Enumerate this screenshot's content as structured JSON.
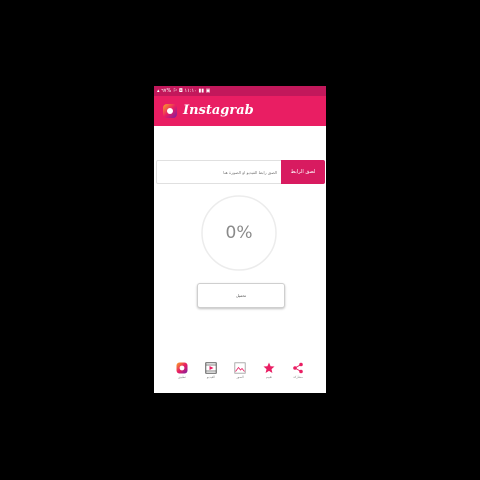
{
  "status_bar": {
    "left_text": "▴ ١١:١٠ ◘ ⚐ %٦٧ ▮▮ ▣"
  },
  "app": {
    "title": "Instagrab"
  },
  "url_input": {
    "placeholder": "الصق رابط الفيديو او الصورة هنا",
    "value": ""
  },
  "paste_button": {
    "label": "لصق الرابط"
  },
  "progress": {
    "percent_text": "0%",
    "value": 0
  },
  "download_button": {
    "label": "تحميل"
  },
  "bottom_nav": {
    "share_label": "مشاركة",
    "rate_label": "تقييم",
    "images_label": "الصور",
    "videos_label": "الفيديو",
    "app_label": "تطبيق"
  },
  "colors": {
    "primary": "#e91e63",
    "primary_dark": "#c2185b",
    "accent": "#d81b60"
  }
}
